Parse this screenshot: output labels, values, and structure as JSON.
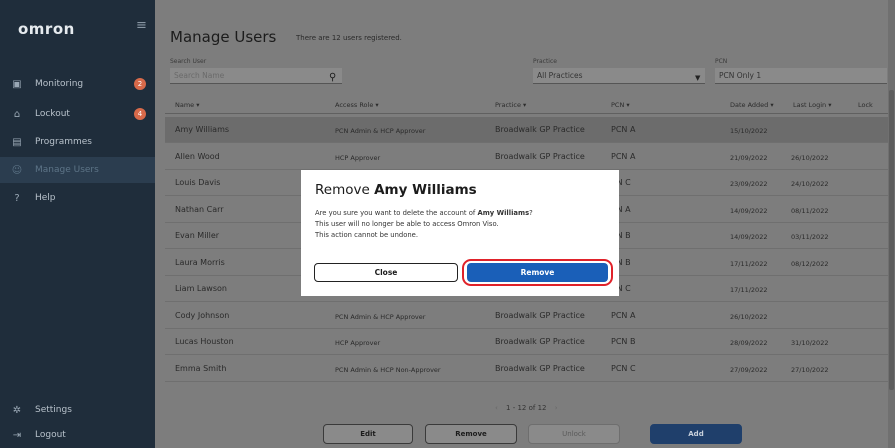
{
  "sidebar": {
    "logo": "omron",
    "menu_icon": "hamburger-icon",
    "items": [
      {
        "label": "Monitoring",
        "icon": "monitor-icon",
        "badge": "2"
      },
      {
        "label": "Lockout",
        "icon": "lock-icon",
        "badge": "4"
      },
      {
        "label": "Programmes",
        "icon": "list-icon"
      },
      {
        "label": "Manage Users",
        "icon": "users-icon",
        "active": true
      },
      {
        "label": "Help",
        "icon": "question-icon"
      }
    ],
    "bottom": [
      {
        "label": "Settings",
        "icon": "gear-icon"
      },
      {
        "label": "Logout",
        "icon": "logout-icon"
      }
    ]
  },
  "header": {
    "title": "Manage Users",
    "registered": "There are 12 users registered."
  },
  "filters": {
    "search_label": "Search User",
    "search_placeholder": "Search Name",
    "practice_label": "Practice",
    "practice_value": "All Practices",
    "pcn_label": "PCN",
    "pcn_value": "PCN Only 1"
  },
  "table": {
    "columns": [
      "Name ▾",
      "Access Role ▾",
      "Practice ▾",
      "PCN ▾",
      "Date Added ▾",
      "Last Login ▾",
      "Lock"
    ],
    "rows": [
      {
        "name": "Amy Williams",
        "role": "PCN Admin & HCP Approver",
        "practice": "Broadwalk GP Practice",
        "pcn": "PCN A",
        "added": "15/10/2022",
        "login": ""
      },
      {
        "name": "Allen Wood",
        "role": "HCP Approver",
        "practice": "Broadwalk GP Practice",
        "pcn": "PCN A",
        "added": "21/09/2022",
        "login": "26/10/2022"
      },
      {
        "name": "Louis Davis",
        "role": "",
        "practice": "",
        "pcn": "CN C",
        "added": "23/09/2022",
        "login": "24/10/2022"
      },
      {
        "name": "Nathan Carr",
        "role": "",
        "practice": "",
        "pcn": "CN A",
        "added": "14/09/2022",
        "login": "08/11/2022"
      },
      {
        "name": "Evan Miller",
        "role": "",
        "practice": "",
        "pcn": "CN B",
        "added": "14/09/2022",
        "login": "03/11/2022"
      },
      {
        "name": "Laura Morris",
        "role": "",
        "practice": "",
        "pcn": "CN B",
        "added": "17/11/2022",
        "login": "08/12/2022"
      },
      {
        "name": "Liam Lawson",
        "role": "",
        "practice": "",
        "pcn": "CN C",
        "added": "17/11/2022",
        "login": ""
      },
      {
        "name": "Cody Johnson",
        "role": "PCN Admin & HCP Approver",
        "practice": "Broadwalk GP Practice",
        "pcn": "PCN A",
        "added": "26/10/2022",
        "login": ""
      },
      {
        "name": "Lucas Houston",
        "role": "HCP Approver",
        "practice": "Broadwalk GP Practice",
        "pcn": "PCN B",
        "added": "28/09/2022",
        "login": "31/10/2022"
      },
      {
        "name": "Emma Smith",
        "role": "PCN Admin & HCP Non-Approver",
        "practice": "Broadwalk GP Practice",
        "pcn": "PCN C",
        "added": "27/09/2022",
        "login": "27/10/2022"
      }
    ]
  },
  "pager": {
    "text": "1 - 12 of 12",
    "prev": "‹",
    "next": "›"
  },
  "actions": {
    "edit": "Edit",
    "remove": "Remove",
    "unlock": "Unlock",
    "add": "Add"
  },
  "modal": {
    "title_prefix": "Remove ",
    "title_name": "Amy Williams",
    "line1_prefix": "Are you sure you want to delete the account of ",
    "line1_name": "Amy Williams",
    "line1_suffix": "?",
    "line2": "This user will no longer be able to access Omron Viso.",
    "line3": "This action cannot be undone.",
    "close": "Close",
    "remove": "Remove",
    "highlight_color": "#e0222a",
    "primary_color": "#1a5fb8"
  }
}
